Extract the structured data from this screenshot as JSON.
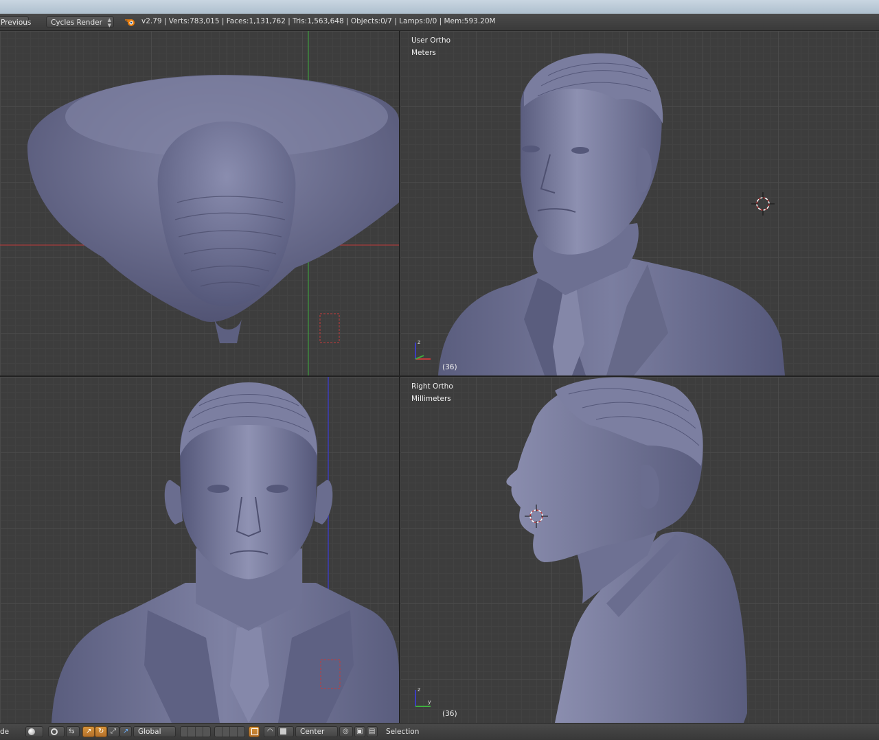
{
  "header": {
    "previous_label": "Previous",
    "render_engine": "Cycles Render",
    "stats": "v2.79 | Verts:783,015 | Faces:1,131,762 | Tris:1,563,648 | Objects:0/7 | Lamps:0/0 | Mem:593.20M"
  },
  "viewports": {
    "top_left": {
      "view": "",
      "units": ""
    },
    "top_right": {
      "view": "User Ortho",
      "units": "Meters",
      "frame": "(36)"
    },
    "bottom_left": {
      "view": "",
      "units": ""
    },
    "bottom_right": {
      "view": "Right Ortho",
      "units": "Millimeters",
      "frame": "(36)"
    }
  },
  "footer": {
    "mode_fragment": "de",
    "orientation": "Global",
    "pivot": "Center",
    "selection_label": "Selection"
  },
  "colors": {
    "model": "#6c6f8e",
    "grid_bg": "#3d3d3d",
    "x_axis": "#c23b3b",
    "y_axis": "#3fae3f",
    "z_axis": "#3d3dbd",
    "active_orange": "#d4923a"
  },
  "icons": [
    "blender-logo-icon",
    "cursor-icon",
    "axis-gizmo-icon",
    "shading-sphere-icon",
    "manipulator-icon",
    "snap-icon",
    "render-icon"
  ]
}
